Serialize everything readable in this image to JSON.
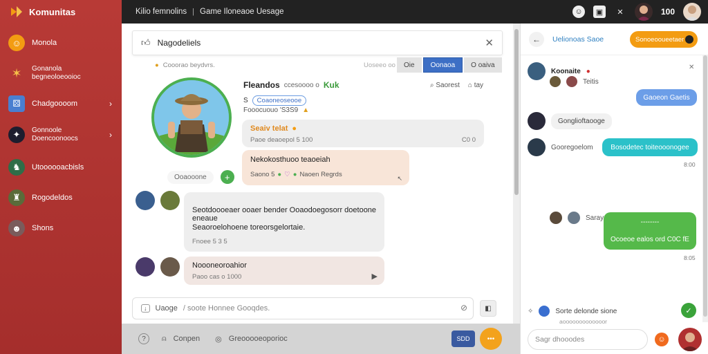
{
  "app": {
    "brand": "Komunitas"
  },
  "sidebar": {
    "items": [
      {
        "label": "Monola",
        "icon": "emoji-face-icon"
      },
      {
        "label": "Gonanola\nbegneoloeooioc",
        "icon": "party-icon"
      },
      {
        "label": "Chadgoooom",
        "icon": "dice-icon",
        "chevron": true
      },
      {
        "label": "Gonnoole\nDoencoonoocs",
        "icon": "gamepad-icon",
        "chevron": true
      },
      {
        "label": "Utoooooacbisls",
        "icon": "character-icon"
      },
      {
        "label": "Rogodeldos",
        "icon": "hero-icon"
      },
      {
        "label": "Shons",
        "icon": "profile-icon"
      }
    ]
  },
  "topbar": {
    "tabs": [
      "Kilio femnolins",
      "Game Iloneaoe Uesage"
    ],
    "count": "100"
  },
  "search": {
    "title": "Nagodeliels"
  },
  "meta": {
    "left": "Cooorao beydvrs.",
    "right": "Uoseeo oo"
  },
  "segments": [
    {
      "label": "Oie",
      "active": false
    },
    {
      "label": "Oonaoa",
      "active": true
    },
    {
      "label": "O oaiva",
      "active": false
    }
  ],
  "profile": {
    "name": "Fleandos",
    "sub": "ccesoooo o",
    "badge": "Kuk",
    "tag": "Coaoneoseooe",
    "tag_prefix": "S",
    "stats": "Fooocuouo 'S3S9",
    "action1": "Saorest",
    "action2": "tay",
    "follow_label": "Ooaooone"
  },
  "posts": [
    {
      "title": "Seaiv telat",
      "meta": "Paoe deaoepol 5 100",
      "meta_right": "C0 0"
    },
    {
      "title": "Nekokosthuoo teaoeiah",
      "meta": "Saono 5 ",
      "meta_right": "Naoen Regrds"
    },
    {
      "text1": "Seotdoooeaer ooaer bender Ooaodoegosorr doetoone",
      "text2": "eneaue",
      "text3": "Seaoroelohoene toreorsgelortaie.",
      "meta": "Fnoee  5 3 5"
    },
    {
      "title": "Noooneoroahior",
      "meta": "Paoo  cas o 1000"
    }
  ],
  "composer": {
    "label": "Uaoge",
    "placeholder": "/ soote Honnee Gooqdes."
  },
  "bottombar": {
    "item1": "Conpen",
    "item2": "Greooooeoporioc",
    "btn": "SDD",
    "btn2": "•••"
  },
  "chat": {
    "title": "Uelionoas Saoe",
    "cta": "Sonoeooueetaer",
    "messages": [
      {
        "name": "Koonaite",
        "sub": "Teitis",
        "bubble": "Gaoeon Gaetis",
        "time": ""
      },
      {
        "name": "Gonglioftaooge",
        "bubble": "",
        "time": ""
      },
      {
        "name": "Gooregoelom",
        "bubble": "Bosodetec toiteooonogee",
        "time": "8:00"
      },
      {
        "name": "Sarayo",
        "bubble": "Ocoeoe ealos ord C0C fE",
        "bubble_top": "--------",
        "time": "8:05"
      }
    ],
    "footer_line": "Sorte delonde sione",
    "footer_sub": "aooooooooooooor",
    "input_placeholder": "Sagr dhooodes"
  },
  "colors": {
    "sidebar": "#b83a36",
    "topbar": "#222222",
    "accent_blue": "#3d6fc5",
    "accent_orange": "#f39c12",
    "accent_green": "#4caf50"
  }
}
